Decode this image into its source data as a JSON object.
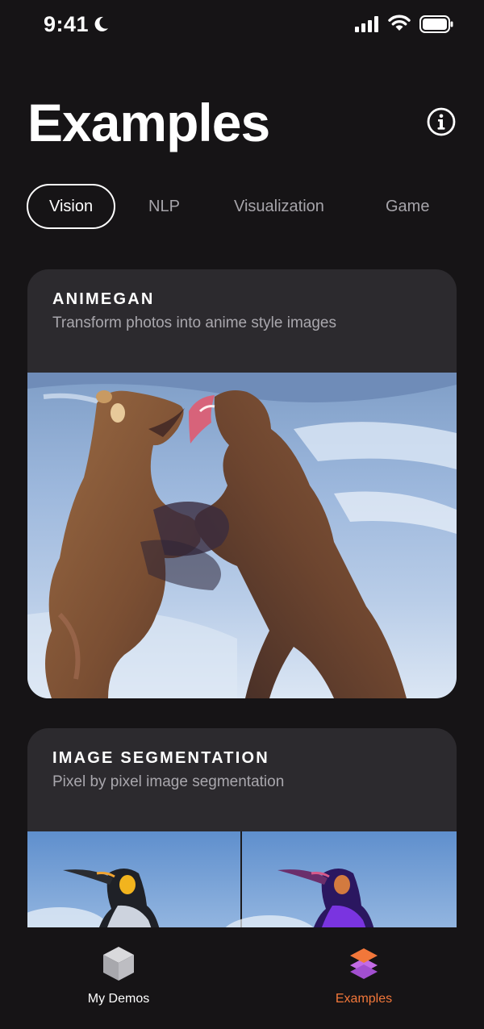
{
  "status_bar": {
    "time": "9:41",
    "icons": [
      "moon-icon",
      "cellular-signal-icon",
      "wifi-icon",
      "battery-icon"
    ]
  },
  "header": {
    "title": "Examples",
    "info_icon": "info-icon"
  },
  "tabs": [
    {
      "label": "Vision",
      "active": true
    },
    {
      "label": "NLP",
      "active": false
    },
    {
      "label": "Visualization",
      "active": false
    },
    {
      "label": "Game",
      "active": false
    }
  ],
  "cards": [
    {
      "title": "ANIMEGAN",
      "subtitle": "Transform photos into anime style images",
      "image": "anime-style fighting bears"
    },
    {
      "title": "IMAGE SEGMENTATION",
      "subtitle": "Pixel by pixel image segmentation",
      "image": "penguin original and segmented"
    }
  ],
  "tab_bar": {
    "items": [
      {
        "label": "My Demos",
        "icon": "cube-icon",
        "active": false
      },
      {
        "label": "Examples",
        "icon": "layers-icon",
        "active": true
      }
    ]
  },
  "colors": {
    "background": "#161416",
    "card": "#2c2a2e",
    "accent": "#f2773a",
    "muted_text": "#a6a4aa"
  }
}
